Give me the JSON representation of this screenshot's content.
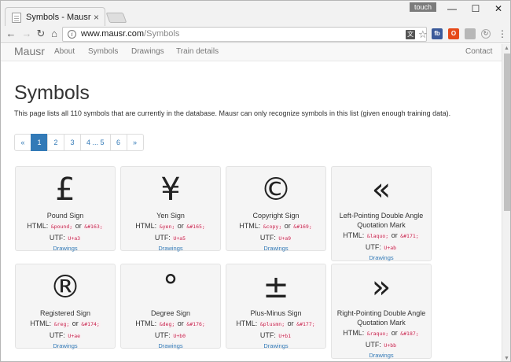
{
  "browser": {
    "tab_title": "Symbols - Mausr",
    "tab_close": "×",
    "touch_badge": "touch",
    "window_controls": {
      "minimize": "—",
      "maximize": "☐",
      "close": "✕"
    },
    "nav": {
      "back": "←",
      "forward": "→",
      "reload": "↻",
      "home": "⌂"
    },
    "url_host": "www.mausr.com",
    "url_path": "/Symbols",
    "extensions": {
      "facebook": "fb",
      "office": "O",
      "gray": "",
      "refresh": "↻"
    },
    "menu": "⋮"
  },
  "site": {
    "brand": "Mausr",
    "nav_links": [
      "About",
      "Symbols",
      "Drawings",
      "Train details"
    ],
    "contact": "Contact"
  },
  "page": {
    "title": "Symbols",
    "lead": "This page lists all 110 symbols that are currently in the database. Mausr can only recognize symbols in this list (given enough training data)."
  },
  "pagination": {
    "prev": "«",
    "pages": [
      "1",
      "2",
      "3",
      "4 ... 5",
      "6"
    ],
    "next": "»",
    "active_page": "1"
  },
  "labels": {
    "html": "HTML:",
    "or": "or",
    "utf": "UTF:",
    "drawings": "Drawings"
  },
  "symbols": [
    {
      "glyph": "£",
      "name": "Pound Sign",
      "html_entity": "&pound;",
      "html_code": "&#163;",
      "utf": "U+a3"
    },
    {
      "glyph": "¥",
      "name": "Yen Sign",
      "html_entity": "&yen;",
      "html_code": "&#165;",
      "utf": "U+a5"
    },
    {
      "glyph": "©",
      "name": "Copyright Sign",
      "html_entity": "&copy;",
      "html_code": "&#169;",
      "utf": "U+a9"
    },
    {
      "glyph": "«",
      "name": "Left-Pointing Double Angle Quotation Mark",
      "html_entity": "&laquo;",
      "html_code": "&#171;",
      "utf": "U+ab"
    },
    {
      "glyph": "®",
      "name": "Registered Sign",
      "html_entity": "&reg;",
      "html_code": "&#174;",
      "utf": "U+ae"
    },
    {
      "glyph": "°",
      "name": "Degree Sign",
      "html_entity": "&deg;",
      "html_code": "&#176;",
      "utf": "U+b0"
    },
    {
      "glyph": "±",
      "name": "Plus-Minus Sign",
      "html_entity": "&plusmn;",
      "html_code": "&#177;",
      "utf": "U+b1"
    },
    {
      "glyph": "»",
      "name": "Right-Pointing Double Angle Quotation Mark",
      "html_entity": "&raquo;",
      "html_code": "&#187;",
      "utf": "U+bb"
    }
  ]
}
